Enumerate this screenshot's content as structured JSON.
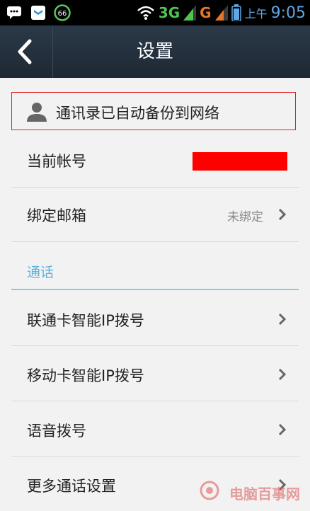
{
  "status_bar": {
    "network_3g": "3G",
    "network_g": "G",
    "ampm": "上午",
    "time": "9:05",
    "badge": "66"
  },
  "header": {
    "title": "设置"
  },
  "backup_notice": {
    "text": "通讯录已自动备份到网络"
  },
  "account": {
    "current_account_label": "当前帐号",
    "bind_email_label": "绑定邮箱",
    "bind_email_value": "未绑定"
  },
  "call_section": {
    "title": "通话",
    "items": [
      {
        "label": "联通卡智能IP拨号"
      },
      {
        "label": "移动卡智能IP拨号"
      },
      {
        "label": "语音拨号"
      },
      {
        "label": "更多通话设置"
      }
    ]
  },
  "watermark": {
    "text": "电脑百事网"
  },
  "colors": {
    "titlebar": "#2b3948",
    "accent_blue": "#5fb0d8",
    "redaction": "#ff0000"
  }
}
